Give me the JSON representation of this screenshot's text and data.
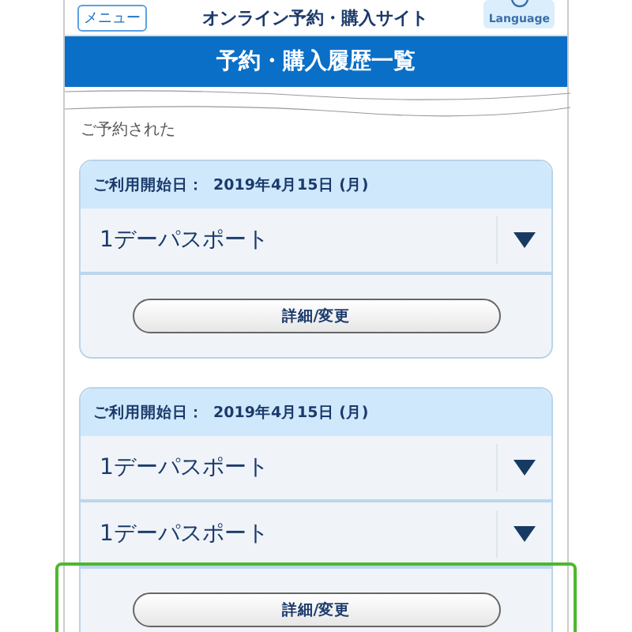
{
  "header": {
    "menu_button": "メニュー",
    "site_title": "オンライン予約・購入サイト",
    "language_button": "Language"
  },
  "page_title": "予約・購入履歴一覧",
  "intro": "ご予約された",
  "bookings": [
    {
      "date_label": "ご利用開始日：",
      "date": "2019年4月15日 (月)",
      "tickets": [
        {
          "name": "1デーパスポート"
        }
      ],
      "action": "詳細/変更",
      "highlighted": false
    },
    {
      "date_label": "ご利用開始日：",
      "date": "2019年4月15日 (月)",
      "tickets": [
        {
          "name": "1デーパスポート"
        },
        {
          "name": "1デーパスポート"
        }
      ],
      "action": "詳細/変更",
      "highlighted": true
    }
  ]
}
